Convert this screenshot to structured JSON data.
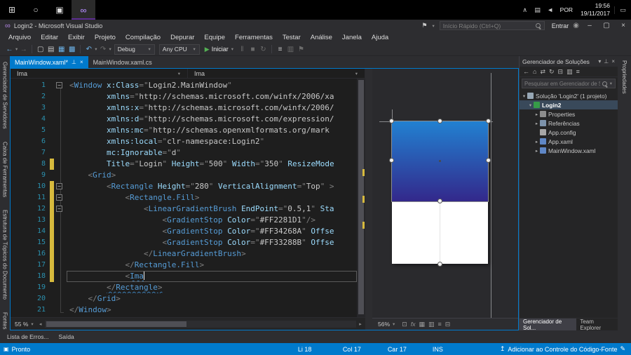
{
  "colors": {
    "accent": "#007acc",
    "modified_marker": "#d7ba3d",
    "statusbar": "#007acc"
  },
  "icons": {
    "start": "⊞",
    "search_circle": "○",
    "task_view": "▣",
    "vs_logo": "∞",
    "tray_expand": "∧",
    "display": "▤",
    "volume": "◄",
    "notification": "▭",
    "flag": "⚑",
    "user": "◉",
    "minimize": "–",
    "maximize": "▢",
    "close": "×",
    "back": "←",
    "forward": "→",
    "new_project": "▢",
    "open_file": "▤",
    "save": "▦",
    "save_all": "▩",
    "undo": "↶",
    "redo": "↷",
    "chevron_down": "▾",
    "run": "▶",
    "pause": "‖",
    "stop": "■",
    "refresh": "↻",
    "home": "⌂",
    "collapse_all": "⊟",
    "sync": "⇄",
    "properties_btn": "≡",
    "show_all": "▥",
    "pin": "⊥",
    "expanded": "▾",
    "collapsed": "▸",
    "zoom_fit": "⊡",
    "grid": "▦",
    "grid2": "▥",
    "guides": "≡",
    "effects": "fx",
    "scroll_left": "◂",
    "scroll_right": "▸",
    "source_control": "↥",
    "pencil": "✎",
    "ready": "▣"
  },
  "taskbar": {
    "time": "19:56",
    "date": "19/11/2017",
    "lang": "POR"
  },
  "titlebar": {
    "title": "Login2 - Microsoft Visual Studio",
    "search_placeholder": "Início Rápido (Ctrl+Q)",
    "signin": "Entrar"
  },
  "menus": [
    "Arquivo",
    "Editar",
    "Exibir",
    "Projeto",
    "Compilação",
    "Depurar",
    "Equipe",
    "Ferramentas",
    "Testar",
    "Análise",
    "Janela",
    "Ajuda"
  ],
  "toolbar": {
    "config": "Debug",
    "platform": "Any CPU",
    "run": "Iniciar"
  },
  "side_tabs": [
    "Gerenciador de Servidores",
    "Caixa de Ferramentas",
    "Estrutura de Tópicos do Documento",
    "Fontes de Dados"
  ],
  "right_tabs": [
    "Propriedades"
  ],
  "doc_tabs": [
    {
      "label": "MainWindow.xaml*",
      "active": true
    },
    {
      "label": "MainWindow.xaml.cs",
      "active": false
    }
  ],
  "navbar": {
    "left": "Ima",
    "right": "Ima"
  },
  "editor": {
    "zoom": "55 %"
  },
  "designer": {
    "zoom": "56%",
    "gradient_top": "#2281D1",
    "gradient_bottom": "#33288B"
  },
  "code": {
    "lines": [
      {
        "n": 1,
        "f": true,
        "s": [
          [
            "d",
            "<"
          ],
          [
            "t",
            "Window"
          ],
          [
            "p",
            " "
          ],
          [
            "a",
            "x:Class"
          ],
          [
            "d",
            "=\""
          ],
          [
            "v",
            "Login2.MainWindow"
          ],
          [
            "d",
            "\""
          ]
        ]
      },
      {
        "n": 2,
        "s": [
          [
            "p",
            "        "
          ],
          [
            "a",
            "xmlns"
          ],
          [
            "d",
            "=\""
          ],
          [
            "v",
            "http://schemas.microsoft.com/winfx/2006/xa"
          ]
        ]
      },
      {
        "n": 3,
        "s": [
          [
            "p",
            "        "
          ],
          [
            "a",
            "xmlns:x"
          ],
          [
            "d",
            "=\""
          ],
          [
            "v",
            "http://schemas.microsoft.com/winfx/2006/"
          ]
        ]
      },
      {
        "n": 4,
        "s": [
          [
            "p",
            "        "
          ],
          [
            "a",
            "xmlns:d"
          ],
          [
            "d",
            "=\""
          ],
          [
            "v",
            "http://schemas.microsoft.com/expression/"
          ]
        ]
      },
      {
        "n": 5,
        "s": [
          [
            "p",
            "        "
          ],
          [
            "a",
            "xmlns:mc"
          ],
          [
            "d",
            "=\""
          ],
          [
            "v",
            "http://schemas.openxmlformats.org/mark"
          ]
        ]
      },
      {
        "n": 6,
        "s": [
          [
            "p",
            "        "
          ],
          [
            "a",
            "xmlns:local"
          ],
          [
            "d",
            "=\""
          ],
          [
            "v",
            "clr-namespace:Login2"
          ],
          [
            "d",
            "\""
          ]
        ]
      },
      {
        "n": 7,
        "s": [
          [
            "p",
            "        "
          ],
          [
            "a",
            "mc:Ignorable"
          ],
          [
            "d",
            "=\""
          ],
          [
            "v",
            "d"
          ],
          [
            "d",
            "\""
          ]
        ]
      },
      {
        "n": 8,
        "c": true,
        "s": [
          [
            "p",
            "        "
          ],
          [
            "a",
            "Title"
          ],
          [
            "d",
            "=\""
          ],
          [
            "v",
            "Login"
          ],
          [
            "d",
            "\" "
          ],
          [
            "a",
            "Height"
          ],
          [
            "d",
            "=\""
          ],
          [
            "v",
            "500"
          ],
          [
            "d",
            "\" "
          ],
          [
            "a",
            "Width"
          ],
          [
            "d",
            "=\""
          ],
          [
            "v",
            "350"
          ],
          [
            "d",
            "\" "
          ],
          [
            "a",
            "ResizeMode"
          ]
        ]
      },
      {
        "n": 9,
        "s": [
          [
            "p",
            "    "
          ],
          [
            "d",
            "<"
          ],
          [
            "t",
            "Grid"
          ],
          [
            "d",
            ">"
          ]
        ]
      },
      {
        "n": 10,
        "c": true,
        "f": true,
        "s": [
          [
            "p",
            "        "
          ],
          [
            "d",
            "<"
          ],
          [
            "t",
            "Rectangle"
          ],
          [
            "p",
            " "
          ],
          [
            "a",
            "Height"
          ],
          [
            "d",
            "=\""
          ],
          [
            "v",
            "280"
          ],
          [
            "d",
            "\" "
          ],
          [
            "a",
            "VerticalAlignment"
          ],
          [
            "d",
            "=\""
          ],
          [
            "v",
            "Top"
          ],
          [
            "d",
            "\" >"
          ]
        ]
      },
      {
        "n": 11,
        "c": true,
        "f": true,
        "s": [
          [
            "p",
            "            "
          ],
          [
            "d",
            "<"
          ],
          [
            "t",
            "Rectangle.Fill"
          ],
          [
            "d",
            ">"
          ]
        ]
      },
      {
        "n": 12,
        "c": true,
        "f": true,
        "s": [
          [
            "p",
            "                "
          ],
          [
            "d",
            "<"
          ],
          [
            "t",
            "LinearGradientBrush"
          ],
          [
            "p",
            " "
          ],
          [
            "a",
            "EndPoint"
          ],
          [
            "d",
            "=\""
          ],
          [
            "v",
            "0.5,1"
          ],
          [
            "d",
            "\" "
          ],
          [
            "a",
            "Sta"
          ]
        ]
      },
      {
        "n": 13,
        "c": true,
        "s": [
          [
            "p",
            "                    "
          ],
          [
            "d",
            "<"
          ],
          [
            "t",
            "GradientStop"
          ],
          [
            "p",
            " "
          ],
          [
            "a",
            "Color"
          ],
          [
            "d",
            "=\""
          ],
          [
            "v",
            "#FF2281D1"
          ],
          [
            "d",
            "\"/>"
          ]
        ]
      },
      {
        "n": 14,
        "c": true,
        "s": [
          [
            "p",
            "                    "
          ],
          [
            "d",
            "<"
          ],
          [
            "t",
            "GradientStop"
          ],
          [
            "p",
            " "
          ],
          [
            "a",
            "Color"
          ],
          [
            "d",
            "=\""
          ],
          [
            "v",
            "#FF34268A"
          ],
          [
            "d",
            "\" "
          ],
          [
            "a",
            "Offse"
          ]
        ]
      },
      {
        "n": 15,
        "c": true,
        "s": [
          [
            "p",
            "                    "
          ],
          [
            "d",
            "<"
          ],
          [
            "t",
            "GradientStop"
          ],
          [
            "p",
            " "
          ],
          [
            "a",
            "Color"
          ],
          [
            "d",
            "=\""
          ],
          [
            "v",
            "#FF33288B"
          ],
          [
            "d",
            "\" "
          ],
          [
            "a",
            "Offse"
          ]
        ]
      },
      {
        "n": 16,
        "c": true,
        "s": [
          [
            "p",
            "                "
          ],
          [
            "d",
            "</"
          ],
          [
            "t",
            "LinearGradientBrush"
          ],
          [
            "d",
            ">"
          ]
        ]
      },
      {
        "n": 17,
        "c": true,
        "s": [
          [
            "p",
            "            "
          ],
          [
            "d",
            "</"
          ],
          [
            "t",
            "Rectangle.Fill"
          ],
          [
            "d",
            ">"
          ]
        ]
      },
      {
        "n": 18,
        "c": true,
        "cur": true,
        "caret": true,
        "s": [
          [
            "p",
            "            "
          ],
          [
            "d",
            "<"
          ],
          [
            "t w",
            "Ima"
          ]
        ]
      },
      {
        "n": 19,
        "s": [
          [
            "p",
            "        "
          ],
          [
            "d w",
            "</"
          ],
          [
            "t w",
            "Rectangle"
          ],
          [
            "d w",
            ">"
          ]
        ]
      },
      {
        "n": 20,
        "s": [
          [
            "p",
            "    "
          ],
          [
            "d",
            "</"
          ],
          [
            "t",
            "Grid"
          ],
          [
            "d",
            ">"
          ]
        ]
      },
      {
        "n": 21,
        "s": [
          [
            "d",
            "</"
          ],
          [
            "t",
            "Window"
          ],
          [
            "d",
            ">"
          ]
        ]
      }
    ]
  },
  "solution_explorer": {
    "title": "Gerenciador de Soluções",
    "search_placeholder": "Pesquisar em Gerenciador de So",
    "tree": [
      {
        "label": "Solução 'Login2' (1 projeto)",
        "level": 0,
        "expand": "open",
        "icon": "solution"
      },
      {
        "label": "Login2",
        "level": 1,
        "expand": "open",
        "icon": "csproj",
        "selected": true,
        "bold": true
      },
      {
        "label": "Properties",
        "level": 2,
        "expand": "closed",
        "icon": "properties"
      },
      {
        "label": "Referências",
        "level": 2,
        "expand": "closed",
        "icon": "references"
      },
      {
        "label": "App.config",
        "level": 2,
        "expand": "none",
        "icon": "config"
      },
      {
        "label": "App.xaml",
        "level": 2,
        "expand": "closed",
        "icon": "xaml"
      },
      {
        "label": "MainWindow.xaml",
        "level": 2,
        "expand": "closed",
        "icon": "xaml"
      }
    ],
    "bottom_tabs": [
      "Gerenciador de Sol...",
      "Team Explorer"
    ]
  },
  "bottom_tabs": [
    "Lista de Erros...",
    "Saída"
  ],
  "statusbar": {
    "ready": "Pronto",
    "line": "Li 18",
    "column": "Col 17",
    "character": "Car 17",
    "mode": "INS",
    "source_control": "Adicionar ao Controle do Código-Fonte"
  }
}
